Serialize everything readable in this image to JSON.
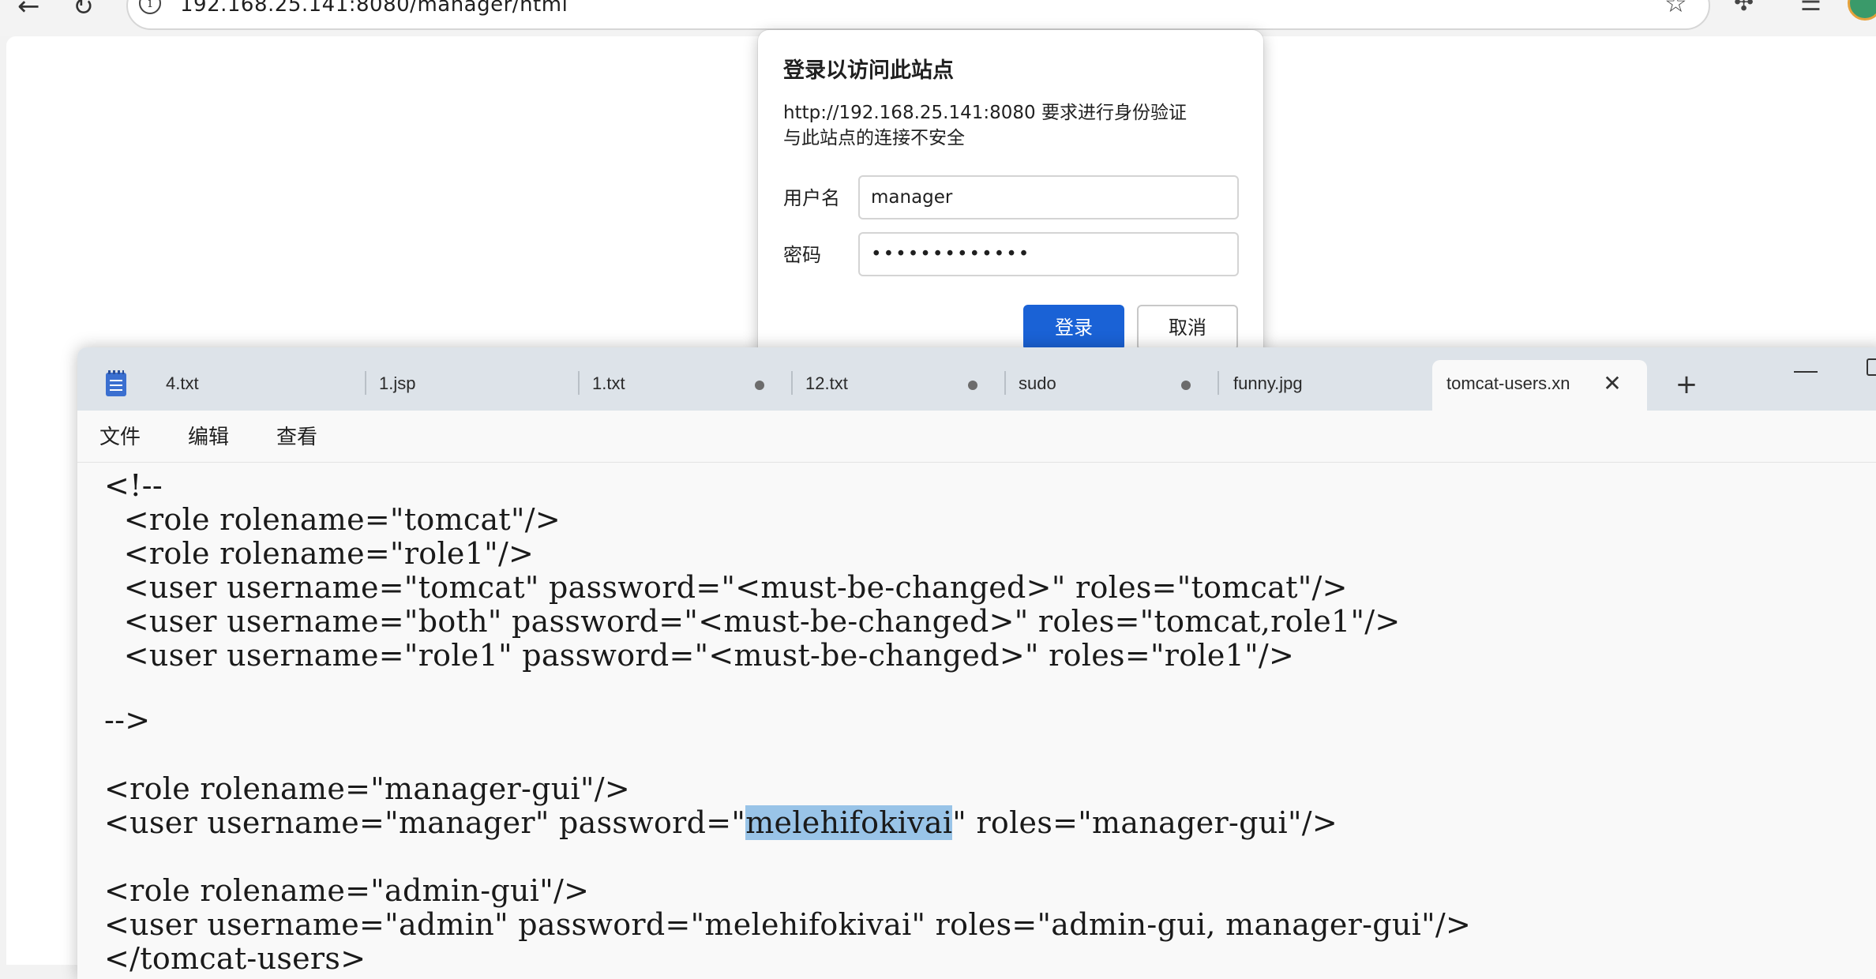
{
  "browser": {
    "url": "192.168.25.141:8080/manager/html",
    "icons": [
      "back-icon",
      "reload-icon",
      "info-icon",
      "star-icon",
      "extensions-icon",
      "favorites-icon",
      "profile-avatar"
    ]
  },
  "login_dialog": {
    "title": "登录以访问此站点",
    "message_line1": "http://192.168.25.141:8080 要求进行身份验证",
    "message_line2": "与此站点的连接不安全",
    "username_label": "用户名",
    "username_value": "manager",
    "password_label": "密码",
    "password_value": "•••••••••••••",
    "login_button": "登录",
    "cancel_button": "取消",
    "accent_color": "#1a62d6"
  },
  "notepad": {
    "tabs": [
      {
        "label": "4.txt",
        "modified": false
      },
      {
        "label": "1.jsp",
        "modified": false
      },
      {
        "label": "1.txt",
        "modified": true
      },
      {
        "label": "12.txt",
        "modified": true
      },
      {
        "label": "sudo",
        "modified": true
      },
      {
        "label": "funny.jpg",
        "modified": false
      },
      {
        "label": "tomcat-users.xn",
        "modified": false,
        "active": true
      }
    ],
    "menu": {
      "file": "文件",
      "edit": "编辑",
      "view": "查看"
    },
    "lines": {
      "l1": "<!--",
      "l2": "  <role rolename=\"tomcat\"/>",
      "l3": "  <role rolename=\"role1\"/>",
      "l4": "  <user username=\"tomcat\" password=\"<must-be-changed>\" roles=\"tomcat\"/>",
      "l5": "  <user username=\"both\" password=\"<must-be-changed>\" roles=\"tomcat,role1\"/>",
      "l6": "  <user username=\"role1\" password=\"<must-be-changed>\" roles=\"role1\"/>",
      "l7": "-->",
      "l8": "<role rolename=\"manager-gui\"/>",
      "l9_pre": "<user username=\"manager\" password=\"",
      "l9_sel": "melehifokivai",
      "l9_post": "\" roles=\"manager-gui\"/>",
      "l10": "<role rolename=\"admin-gui\"/>",
      "l11": "<user username=\"admin\" password=\"melehifokivai\" roles=\"admin-gui, manager-gui\"/>",
      "l12": "</tomcat-users>"
    }
  }
}
